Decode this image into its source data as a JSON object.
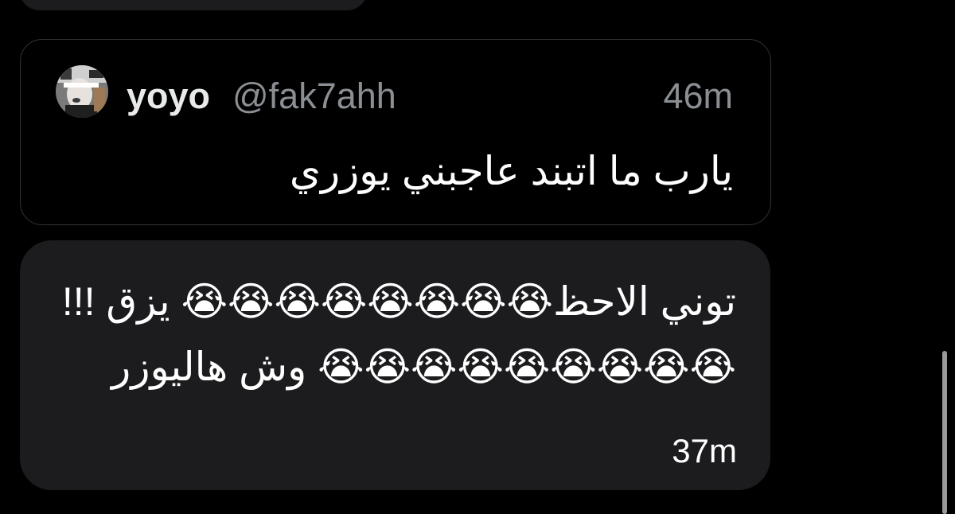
{
  "quoted_tweet": {
    "display_name": "yoyo",
    "handle": "@fak7ahh",
    "time": "46m",
    "text": "يارب ما اتبند عاجبني يوزري"
  },
  "message": {
    "text": "توني الاحظ😭😭😭😭😭😭😭😭 يزق !!!😭😭😭😭😭😭😭😭😭 وش هاليوزر",
    "time": "37m"
  },
  "icons": {
    "avatar": "profile-avatar",
    "emoji": "loudly-crying-face"
  },
  "colors": {
    "background": "#000000",
    "bubble": "#1c1c1e",
    "quote_border": "#2f3336",
    "secondary_text": "#8b8f94",
    "primary_text": "#ffffff"
  }
}
